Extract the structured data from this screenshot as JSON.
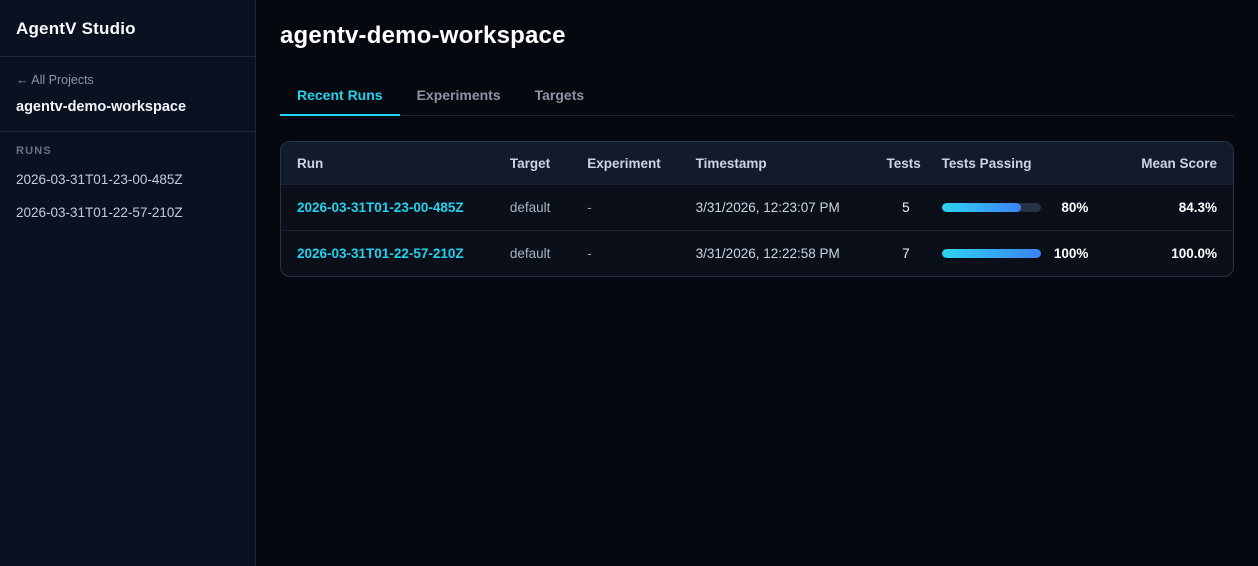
{
  "app": {
    "title": "AgentV Studio"
  },
  "sidebar": {
    "back_link": "← All Projects",
    "project_name": "agentv-demo-workspace",
    "runs_label": "RUNS",
    "runs": [
      "2026-03-31T01-23-00-485Z",
      "2026-03-31T01-22-57-210Z"
    ]
  },
  "main": {
    "title": "agentv-demo-workspace",
    "tabs": [
      {
        "label": "Recent Runs",
        "active": true
      },
      {
        "label": "Experiments",
        "active": false
      },
      {
        "label": "Targets",
        "active": false
      }
    ],
    "table": {
      "columns": [
        "Run",
        "Target",
        "Experiment",
        "Timestamp",
        "Tests",
        "Tests Passing",
        "Mean Score"
      ],
      "rows": [
        {
          "run": "2026-03-31T01-23-00-485Z",
          "target": "default",
          "experiment": "-",
          "timestamp": "3/31/2026, 12:23:07 PM",
          "tests": "5",
          "tests_passing_pct": 80,
          "tests_passing_label": "80%",
          "mean_score": "84.3%"
        },
        {
          "run": "2026-03-31T01-22-57-210Z",
          "target": "default",
          "experiment": "-",
          "timestamp": "3/31/2026, 12:22:58 PM",
          "tests": "7",
          "tests_passing_pct": 100,
          "tests_passing_label": "100%",
          "mean_score": "100.0%"
        }
      ]
    }
  },
  "colors": {
    "accent_cyan": "#22d3ee",
    "progress_gradient_start": "#2dd4ee",
    "progress_gradient_end": "#3b82f6"
  }
}
